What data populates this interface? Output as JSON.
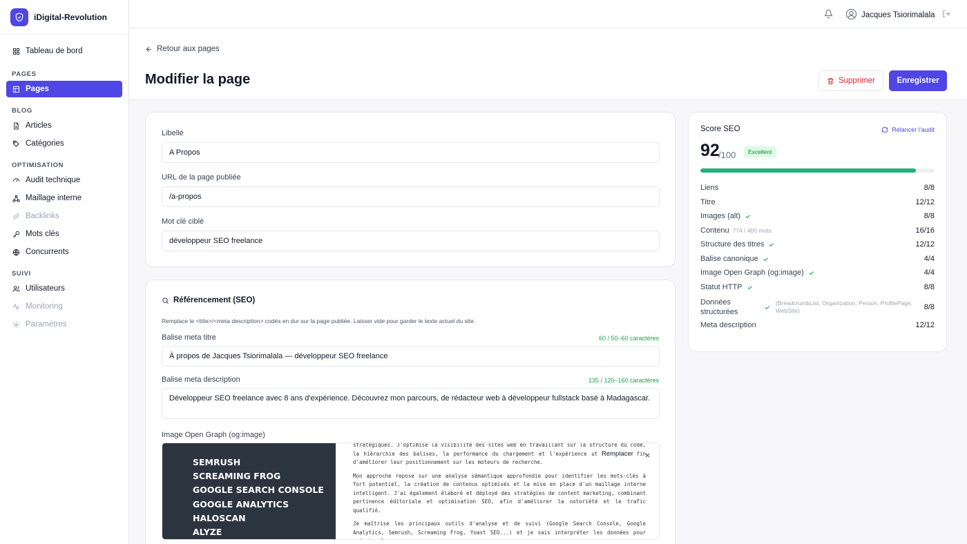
{
  "app": {
    "brand": "iDigital-Revolution"
  },
  "sidebar": {
    "top": [
      {
        "label": "Tableau de bord",
        "icon": "dashboard-icon"
      }
    ],
    "sections": [
      {
        "title": "PAGES",
        "items": [
          {
            "label": "Pages",
            "active": true
          }
        ]
      },
      {
        "title": "BLOG",
        "items": [
          {
            "label": "Articles"
          },
          {
            "label": "Catégories"
          }
        ]
      },
      {
        "title": "OPTIMISATION",
        "items": [
          {
            "label": "Audit technique"
          },
          {
            "label": "Maillage interne"
          },
          {
            "label": "Backlinks",
            "muted": true
          },
          {
            "label": "Mots clés"
          },
          {
            "label": "Concurrents"
          }
        ]
      },
      {
        "title": "SUIVI",
        "items": [
          {
            "label": "Utilisateurs"
          },
          {
            "label": "Monitoring",
            "muted": true
          },
          {
            "label": "Paramètres",
            "muted": true
          }
        ]
      }
    ]
  },
  "topbar": {
    "user_name": "Jacques Tsiorimalala"
  },
  "header": {
    "back_label": "Retour aux pages",
    "title": "Modifier la page",
    "delete_label": "Supprimer",
    "save_label": "Enregistrer"
  },
  "form": {
    "libelle_label": "Libellé",
    "libelle_value": "A Propos",
    "url_label": "URL de la page publiée",
    "url_value": "/a-propos",
    "keyword_label": "Mot clé ciblé",
    "keyword_value": "développeur SEO freelance"
  },
  "seo": {
    "section_title": "Référencement (SEO)",
    "hint": "Remplace le <title>/<meta description> codés en dur sur la page publiée. Laisser vide pour garder le texte actuel du site.",
    "meta_title_label": "Balise meta titre",
    "meta_title_counter": "60 / 50–60 caractères",
    "meta_title_value": "À propos de Jacques Tsiorimalala — développeur SEO freelance",
    "meta_desc_label": "Balise meta description",
    "meta_desc_counter": "135 / 120–160 caractères",
    "meta_desc_value": "Développeur SEO freelance  avec 8 ans d'expérience. Découvrez mon parcours, de rédacteur web à développeur fullstack basé à Madagascar.",
    "og_label": "Image Open Graph (og:image)",
    "og_replace": "Remplacer",
    "og_image": {
      "tools": [
        "SEMRUSH",
        "SCREAMING FROG",
        "GOOGLE SEARCH CONSOLE",
        "GOOGLE ANALYTICS",
        "HALOSCAN",
        "ALYZE"
      ],
      "paragraphs": [
        "stratégiques. J'optimise la visibilité des sites web en travaillant sur la structure du code, la hiérarchie des balises, la performance du chargement et l'expérience utilisateur, afin d'améliorer leur positionnement sur les moteurs de recherche.",
        "Mon approche repose sur une analyse sémantique approfondie pour identifier les mots-clés à fort potentiel, la création de contenus optimisés et la mise en place d'un maillage interne intelligent. J'ai également élaboré et déployé des stratégies de content marketing, combinant pertinence éditoriale et optimisation SEO, afin d'améliorer la notoriété et le trafic qualifié.",
        "Je maîtrise les principaux outils d'analyse et de suivi (Google Search Console, Google Analytics, Semrush, Screaming Frog, Yoast SEO...) et je sais interpréter les données pour orienter les"
      ]
    }
  },
  "score": {
    "title": "Score SEO",
    "relaunch": "Relancer l'audit",
    "value": "92",
    "max": "/100",
    "fill_percent": 92,
    "badge": "Excellent",
    "metrics": [
      {
        "label": "Liens",
        "value": "8/8",
        "check": false
      },
      {
        "label": "Titre",
        "value": "12/12",
        "check": false
      },
      {
        "label": "Images (alt)",
        "value": "8/8",
        "check": true
      },
      {
        "label": "Contenu",
        "note": "774 / 400 mots",
        "value": "16/16",
        "check": false
      },
      {
        "label": "Structure des titres",
        "value": "12/12",
        "check": true
      },
      {
        "label": "Balise canonique",
        "value": "4/4",
        "check": true
      },
      {
        "label": "Image Open Graph (og:image)",
        "value": "4/4",
        "check": true
      },
      {
        "label": "Statut HTTP",
        "value": "8/8",
        "check": true
      },
      {
        "label": "Données structurées",
        "note": "(BreadcrumbList, Organization, Person, ProfilePage, WebSite)",
        "value": "8/8",
        "check": true
      },
      {
        "label": "Meta description",
        "value": "12/12",
        "check": false
      }
    ]
  },
  "colors": {
    "accent": "#4f46e5",
    "success": "#22b07d",
    "danger": "#dc2626"
  }
}
